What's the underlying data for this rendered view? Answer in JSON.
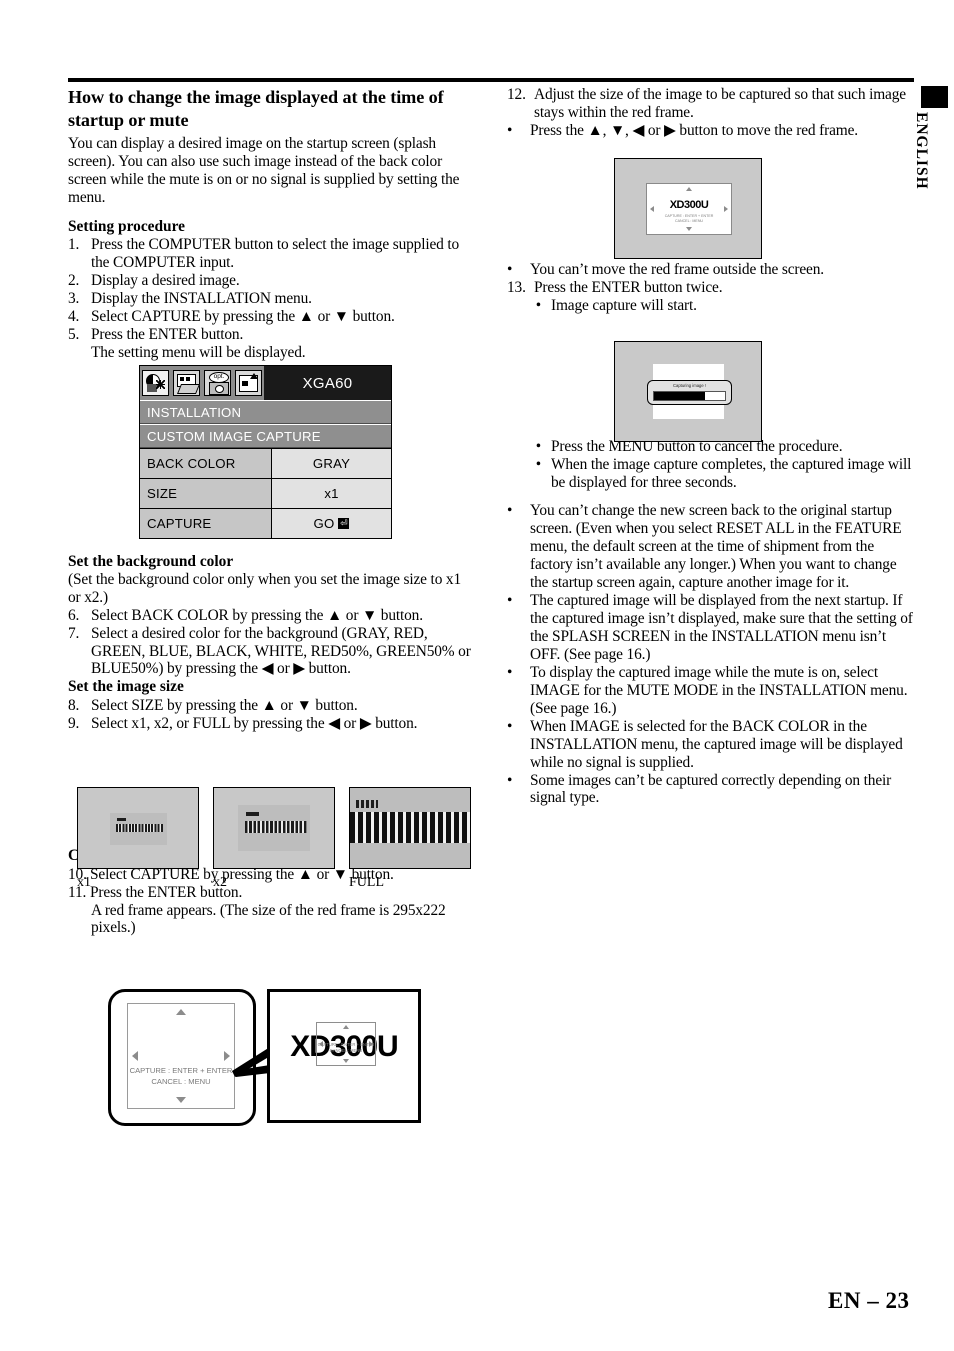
{
  "sidebar": {
    "language_tab": "ENGLISH"
  },
  "footer": {
    "page_label": "EN – 23"
  },
  "left": {
    "title": "How to change the image displayed at the time of startup or mute",
    "intro": "You can display a desired image on the startup screen (splash screen).  You can also use such image instead of the back color screen while the mute is on or no signal is supplied by setting the menu.",
    "setting_procedure_heading": "Setting procedure",
    "steps": [
      {
        "num": "1.",
        "text": "Press the COMPUTER button to select the image supplied to the COMPUTER input."
      },
      {
        "num": "2.",
        "text": "Display a desired image."
      },
      {
        "num": "3.",
        "text": "Display the INSTALLATION menu."
      },
      {
        "num": "4.",
        "text": "Select CAPTURE by pressing the ▲ or ▼ button."
      },
      {
        "num": "5.",
        "text": "Press the ENTER button."
      }
    ],
    "step5_cont": "The setting menu will be displayed.",
    "bg_color_heading": "Set the background color",
    "bg_color_note": "(Set the background color only when you set the image size to x1 or x2.)",
    "steps2": [
      {
        "num": "6.",
        "text": "Select BACK COLOR by pressing the ▲ or ▼ button."
      },
      {
        "num": "7.",
        "text": "Select a desired color for the background (GRAY, RED, GREEN, BLUE, BLACK, WHITE, RED50%, GREEN50% or  BLUE50%) by pressing the ◀ or ▶ button."
      }
    ],
    "image_size_heading": "Set the image size",
    "steps3": [
      {
        "num": "8.",
        "text": "Select SIZE by pressing the ▲ or ▼ button."
      },
      {
        "num": "9.",
        "text": "Select x1, x2, or FULL by pressing the ◀ or ▶ button."
      }
    ],
    "capture_heading": "Capture the image",
    "steps4": [
      {
        "num": "10.",
        "text": "Select CAPTURE by pressing the ▲ or ▼ button."
      },
      {
        "num": "11.",
        "text": "Press the ENTER button."
      }
    ],
    "step11_cont": "A red frame appears.  (The size of the red frame is 295x222 pixels.)"
  },
  "osd_menu": {
    "signal_label": "XGA60",
    "tabs": [
      {
        "icon": "image-adjust-icon",
        "selected": true
      },
      {
        "icon": "installation-projector-icon",
        "selected": false
      },
      {
        "icon": "option-camera-icon",
        "selected": false
      },
      {
        "icon": "feature-picture-icon",
        "selected": false
      }
    ],
    "section_title": "INSTALLATION",
    "sub_title": "CUSTOM IMAGE CAPTURE",
    "rows": [
      {
        "label": "BACK COLOR",
        "value": "GRAY"
      },
      {
        "label": "SIZE",
        "value": "x1"
      },
      {
        "label": "CAPTURE",
        "value": "GO",
        "has_enter_key": true
      }
    ],
    "enter_key_glyph": "⏎"
  },
  "size_figures": [
    {
      "caption": "x1",
      "mode": "x1"
    },
    {
      "caption": "x2",
      "mode": "x2"
    },
    {
      "caption": "FULL",
      "mode": "full"
    }
  ],
  "size_figure_text": {
    "small_label": "1 : 1",
    "main_label": "PROJECTOR XD300U"
  },
  "red_frame_figure": {
    "capture_hint_line1": "CAPTURE : ENTER + ENTER",
    "capture_hint_line2": "CANCEL : MENU",
    "screen_text": "XD300U"
  },
  "right": {
    "steps": [
      {
        "num": "12.",
        "text": "Adjust the size of the image to be captured so that such image stays within the red frame."
      },
      {
        "bullet": "•",
        "text": "Press the ▲, ▼, ◀ or ▶ button to move the red frame."
      }
    ],
    "after_fig1": [
      {
        "bullet": "•",
        "text": "You can’t move the red frame outside the screen."
      },
      {
        "num": "13.",
        "text": "Press the ENTER button twice."
      },
      {
        "bullet": "•",
        "indent": true,
        "text": "Image capture will start."
      }
    ],
    "after_fig2": [
      {
        "bullet": "•",
        "indent": true,
        "text": "Press the MENU button to cancel the procedure."
      },
      {
        "bullet": "•",
        "indent": true,
        "text": "When the image capture completes, the captured image will be displayed for three seconds."
      }
    ],
    "notes": [
      {
        "bullet": "•",
        "text": "You can’t change the new screen back to the original startup screen.  (Even when you select RESET ALL in the FEATURE menu, the default screen at the time of shipment from the factory isn’t available any longer.)  When you want to change the startup screen again, capture another image for it."
      },
      {
        "bullet": "•",
        "text": "The captured image will be displayed from the next startup.  If the captured image isn’t displayed, make sure that the setting of the SPLASH SCREEN in the INSTALLATION menu isn’t OFF.  (See page 16.)"
      },
      {
        "bullet": "•",
        "text": "To display the captured image while the mute is on, select IMAGE for the MUTE MODE in the INSTALLATION menu.  (See page 16.)"
      },
      {
        "bullet": "•",
        "text": "When IMAGE is selected for the BACK COLOR in the INSTALLATION menu, the captured image will be displayed while no signal is supplied."
      },
      {
        "bullet": "•",
        "text": "Some images can’t be captured correctly depending on their signal type."
      }
    ],
    "figure1": {
      "screen_text": "XD300U",
      "hint_line1": "CAPTURE : ENTER + ENTER",
      "hint_line2": "CANCEL : MENU"
    },
    "figure2": {
      "dialog_text": "Capturing image !",
      "progress_percent": 72
    }
  },
  "colors": {
    "osd_title_bg": "#1a1a1a",
    "osd_header_gray": "#8f8f8f",
    "osd_label_gray": "#c6c6c6",
    "osd_value_gray": "#e2e2e2",
    "screen_gray": "#c9c9c9"
  }
}
